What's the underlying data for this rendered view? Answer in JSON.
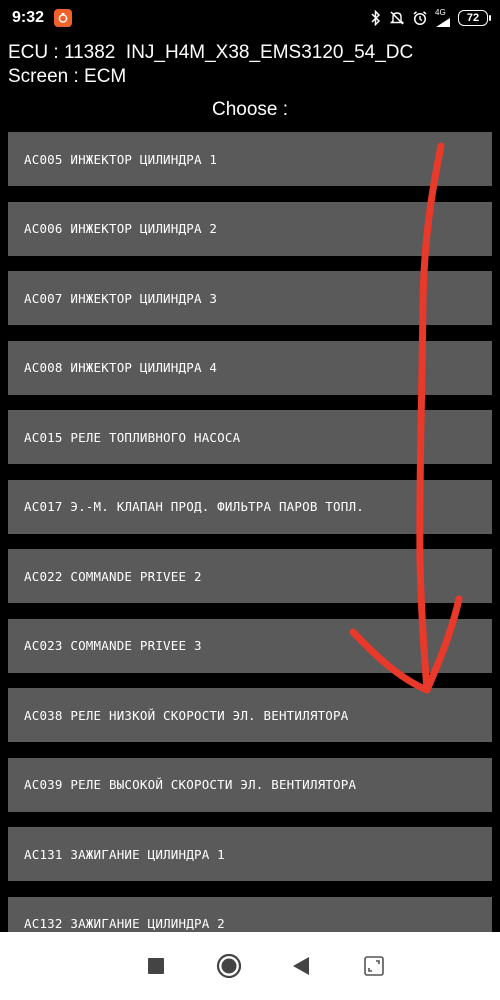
{
  "status_bar": {
    "time": "9:32",
    "network": "4G",
    "battery": "72"
  },
  "header": {
    "ecu": "ECU : 11382  INJ_H4M_X38_EMS3120_54_DC",
    "screen": "Screen : ECM",
    "choose": "Choose :"
  },
  "items": [
    "AC005 ИНЖЕКТОР ЦИЛИНДРА 1",
    "AC006 ИНЖЕКТОР ЦИЛИНДРА 2",
    "AC007 ИНЖЕКТОР ЦИЛИНДРА 3",
    "AC008 ИНЖЕКТОР ЦИЛИНДРА 4",
    "AC015 РЕЛЕ ТОПЛИВНОГО НАСОСА",
    "AC017 Э.-М. КЛАПАН ПРОД. ФИЛЬТРА ПАРОВ ТОПЛ.",
    "AC022 COMMANDE PRIVEE 2",
    "AC023 COMMANDE PRIVEE 3",
    "AC038 РЕЛЕ НИЗКОЙ СКОРОСТИ ЭЛ. ВЕНТИЛЯТОРА",
    "AC039 РЕЛЕ ВЫСОКОЙ СКОРОСТИ ЭЛ. ВЕНТИЛЯТОРА",
    "AC131 ЗАЖИГАНИЕ ЦИЛИНДРА 1",
    "AC132 ЗАЖИГАНИЕ ЦИЛИНДРА 2"
  ],
  "colors": {
    "background": "#000000",
    "item_background": "#5a5a5a",
    "annotation_arrow": "#e8392b",
    "nav_bar": "#ffffff"
  },
  "icons": {
    "status": [
      "notification-app-icon",
      "bluetooth-icon",
      "mute-icon",
      "alarm-icon",
      "signal-icon",
      "battery-icon"
    ],
    "nav": [
      "recent-apps-icon",
      "home-icon",
      "back-icon",
      "screenshot-icon"
    ]
  }
}
